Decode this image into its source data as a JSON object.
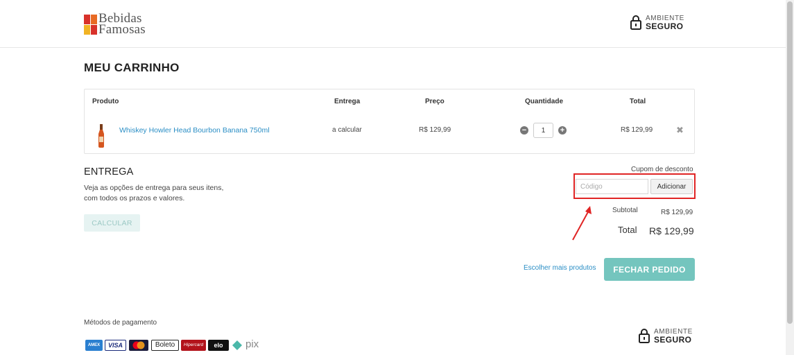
{
  "header": {
    "logo_line1": "Bebidas",
    "logo_line2": "Famosas",
    "secure_line1": "AMBIENTE",
    "secure_line2": "SEGURO"
  },
  "page": {
    "title": "MEU CARRINHO"
  },
  "cart": {
    "columns": {
      "product": "Produto",
      "delivery": "Entrega",
      "price": "Preço",
      "quantity": "Quantidade",
      "total": "Total"
    },
    "items": [
      {
        "name": "Whiskey Howler Head Bourbon Banana 750ml",
        "delivery": "a calcular",
        "price": "R$ 129,99",
        "quantity": "1",
        "total": "R$ 129,99"
      }
    ]
  },
  "shipping": {
    "title": "ENTREGA",
    "desc_line1": "Veja as opções de entrega para seus itens,",
    "desc_line2": "com todos os prazos e valores.",
    "button": "CALCULAR"
  },
  "coupon": {
    "label": "Cupom de desconto",
    "placeholder": "Código",
    "button": "Adicionar"
  },
  "summary": {
    "subtotal_label": "Subtotal",
    "subtotal_value": "R$ 129,99",
    "total_label": "Total",
    "total_value": "R$ 129,99"
  },
  "actions": {
    "more_products": "Escolher mais produtos",
    "checkout": "FECHAR PEDIDO"
  },
  "footer": {
    "payment_label": "Métodos de pagamento",
    "payment_methods": [
      {
        "name": "amex",
        "label": "AMEX"
      },
      {
        "name": "visa",
        "label": "VISA"
      },
      {
        "name": "mastercard",
        "label": ""
      },
      {
        "name": "boleto",
        "label": "Boleto"
      },
      {
        "name": "hipercard",
        "label": "Hipercard"
      },
      {
        "name": "elo",
        "label": "elo"
      },
      {
        "name": "pix",
        "label": "pix"
      }
    ],
    "secure_line1": "AMBIENTE",
    "secure_line2": "SEGURO"
  },
  "colors": {
    "accent": "#74c5be",
    "link": "#2a8ec5",
    "highlight": "#e02424"
  }
}
